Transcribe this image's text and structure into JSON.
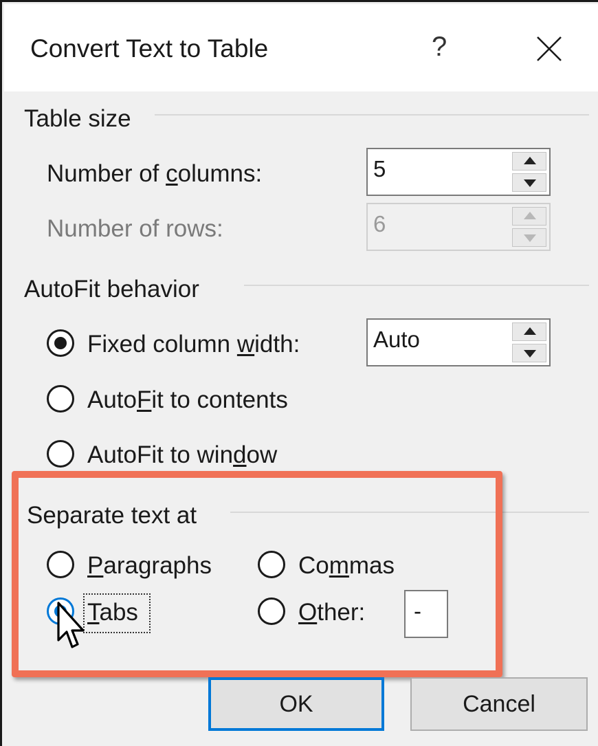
{
  "dialog": {
    "title": "Convert Text to Table",
    "help_label": "?",
    "close_icon": "close-icon"
  },
  "table_size": {
    "group_title": "Table size",
    "columns": {
      "label_pre": "Number of ",
      "label_key": "c",
      "label_post": "olumns:",
      "value": "5"
    },
    "rows": {
      "label": "Number of rows:",
      "value": "6",
      "disabled": true
    }
  },
  "autofit": {
    "group_title": "AutoFit behavior",
    "fixed": {
      "label_pre": "Fixed column ",
      "label_key": "w",
      "label_post": "idth:",
      "selected": true,
      "value": "Auto"
    },
    "contents": {
      "label_pre": "Auto",
      "label_key": "F",
      "label_post": "it to contents",
      "selected": false
    },
    "window": {
      "label_pre": "AutoFit to win",
      "label_key": "d",
      "label_post": "ow",
      "selected": false
    }
  },
  "separate": {
    "group_title": "Separate text at",
    "paragraphs": {
      "label_key": "P",
      "label_post": "aragraphs",
      "selected": false
    },
    "commas": {
      "label_pre": "Co",
      "label_key": "m",
      "label_post": "mas",
      "selected": false
    },
    "tabs": {
      "label_key": "T",
      "label_post": "abs",
      "selected": true
    },
    "other": {
      "label_key": "O",
      "label_post": "ther:",
      "selected": false,
      "value": "-"
    }
  },
  "buttons": {
    "ok": "OK",
    "cancel": "Cancel"
  },
  "colors": {
    "highlight": "#f07156",
    "accent": "#0078d7",
    "dialog_bg": "#f0f0f0"
  }
}
